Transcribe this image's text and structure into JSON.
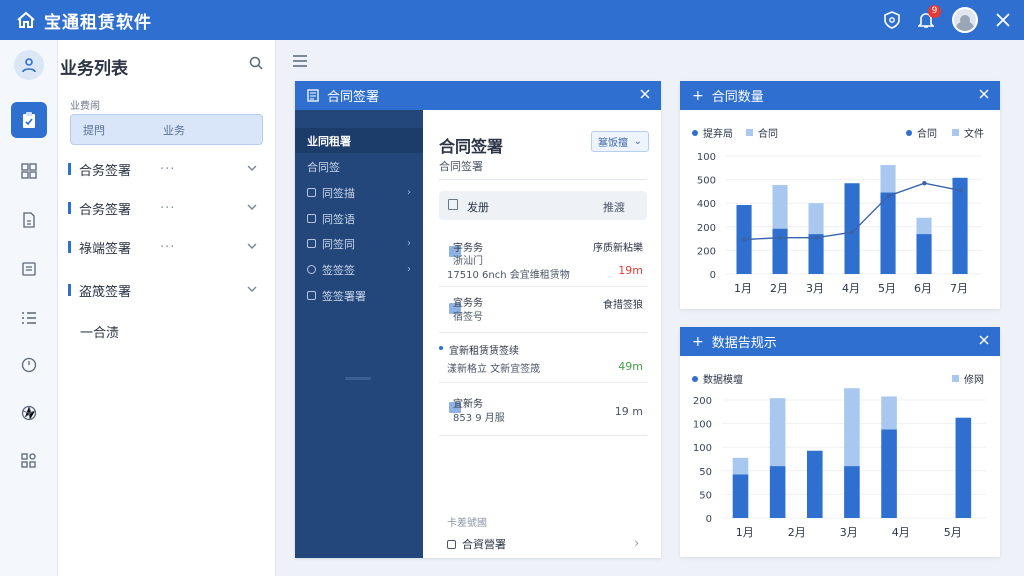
{
  "app": {
    "title": "宝通租赁软件",
    "notification_count": "9"
  },
  "sidebar": {
    "title": "业务列表",
    "filter_label": "业费闹",
    "filter_left": "提閂",
    "filter_right": "业务",
    "groups": [
      {
        "label": "合务签署",
        "more": "···"
      },
      {
        "label": "合务签署",
        "more": "···"
      },
      {
        "label": "祿端签署",
        "more": "···"
      },
      {
        "label": "盗筬签署",
        "more": ""
      }
    ],
    "plain_item": "一合渍"
  },
  "contract_panel": {
    "title": "合同签署",
    "nav": [
      "业同租署",
      "合同签",
      "同签描",
      "同签语",
      "同签同",
      "签签签",
      "签签署署"
    ],
    "content_title": "合同签署",
    "content_sub": "合同签署",
    "dropdown": "簊饭擅",
    "search_left": "发册",
    "search_right": "推渡",
    "rows": [
      {
        "t1": "宇务务",
        "t2a": "浙汕门",
        "t2b": "17510 6nch 会宜维租赁物",
        "right1": "序质新粘樂",
        "right2": "19m",
        "right2_color": "#e53935"
      },
      {
        "t1": "宜务务",
        "t2a": "宿签号",
        "right1": "食措签狼"
      },
      {
        "t1": "宜新租赁赁签续",
        "t2a": "漾新格立 文新宜签筬",
        "right2": "49m",
        "right2_color": "#43a047"
      },
      {
        "t1": "宜新务",
        "t2a": "853 9 月服",
        "right2": "19 m"
      }
    ],
    "footer_label": "卡差號國",
    "footer_item": "合資營署"
  },
  "chart1": {
    "title": "合同数量",
    "legend": [
      "提弃局",
      "合同",
      "合同",
      "文件"
    ],
    "colors": {
      "bar": "#2f6fcf",
      "bar_light": "#a9c8f0",
      "line": "#3a64a8",
      "line2": "#8fb7e8"
    }
  },
  "chart2": {
    "title": "数据告规示",
    "legend": [
      "数据模壇",
      "修网"
    ]
  },
  "chart_data": [
    {
      "type": "bar",
      "categories": [
        "1月",
        "2月",
        "3月",
        "4月",
        "5月",
        "6月",
        "7月"
      ],
      "yticks": [
        "100",
        "500",
        "400",
        "200",
        "200",
        "0"
      ],
      "ylim": [
        0,
        650
      ],
      "series": [
        {
          "name": "合同",
          "values": [
            380,
            250,
            220,
            500,
            450,
            220,
            530
          ]
        },
        {
          "name": "文件",
          "values": [
            0,
            240,
            170,
            0,
            150,
            90,
            0
          ]
        }
      ],
      "lines": [
        {
          "name": "提弃局",
          "values": [
            190,
            200,
            200,
            230,
            430,
            500,
            460
          ]
        }
      ]
    },
    {
      "type": "bar",
      "categories": [
        "1月",
        "2月",
        "3月",
        "4月",
        "5月"
      ],
      "yticks": [
        "200",
        "100",
        "100",
        "50",
        "50",
        "0"
      ],
      "ylim": [
        0,
        200
      ],
      "series": [
        {
          "name": "数据模壇",
          "values": [
            74,
            88,
            114,
            88,
            150,
            0,
            170
          ]
        },
        {
          "name": "修网",
          "values": [
            28,
            115,
            0,
            132,
            56,
            0,
            0
          ]
        }
      ]
    }
  ]
}
